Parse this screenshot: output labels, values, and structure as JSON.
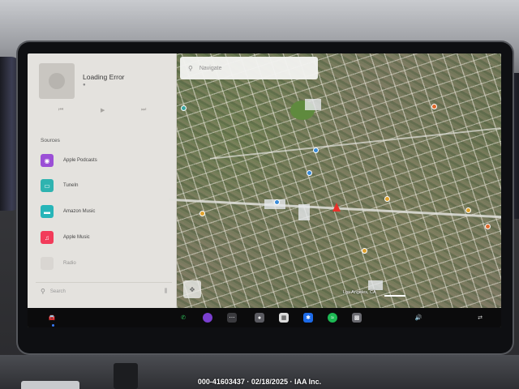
{
  "media": {
    "track_title": "Loading Error",
    "status_dot": "●",
    "controls": {
      "prev": "⏮",
      "play": "▶",
      "next": "⏭"
    },
    "sources_label": "Sources",
    "sources": [
      {
        "label": "Apple Podcasts",
        "icon": "podcasts-icon",
        "color": "#9b4fd6",
        "glyph": "◉"
      },
      {
        "label": "TuneIn",
        "icon": "tunein-icon",
        "color": "#2fb3b0",
        "glyph": "▭"
      },
      {
        "label": "Amazon Music",
        "icon": "amazon-music-icon",
        "color": "#27b5b8",
        "glyph": "▬"
      },
      {
        "label": "Apple Music",
        "icon": "apple-music-icon",
        "color": "#f23b5a",
        "glyph": "♫"
      },
      {
        "label": "Radio",
        "icon": "radio-icon",
        "color": "#cfccc7",
        "glyph": ""
      }
    ],
    "search_label": "Search",
    "equalizer_glyph": "⫼"
  },
  "map": {
    "navigate_placeholder": "Navigate",
    "city_label": "Los Angeles, CA",
    "route_arrow_color": "#e8302a"
  },
  "taskbar": {
    "car_glyph": "🚘",
    "phone_glyph": "✆",
    "volume_glyph": "🔊",
    "swap_glyph": "⇄"
  },
  "caption": "000-41603437 · 02/18/2025 · IAA Inc."
}
